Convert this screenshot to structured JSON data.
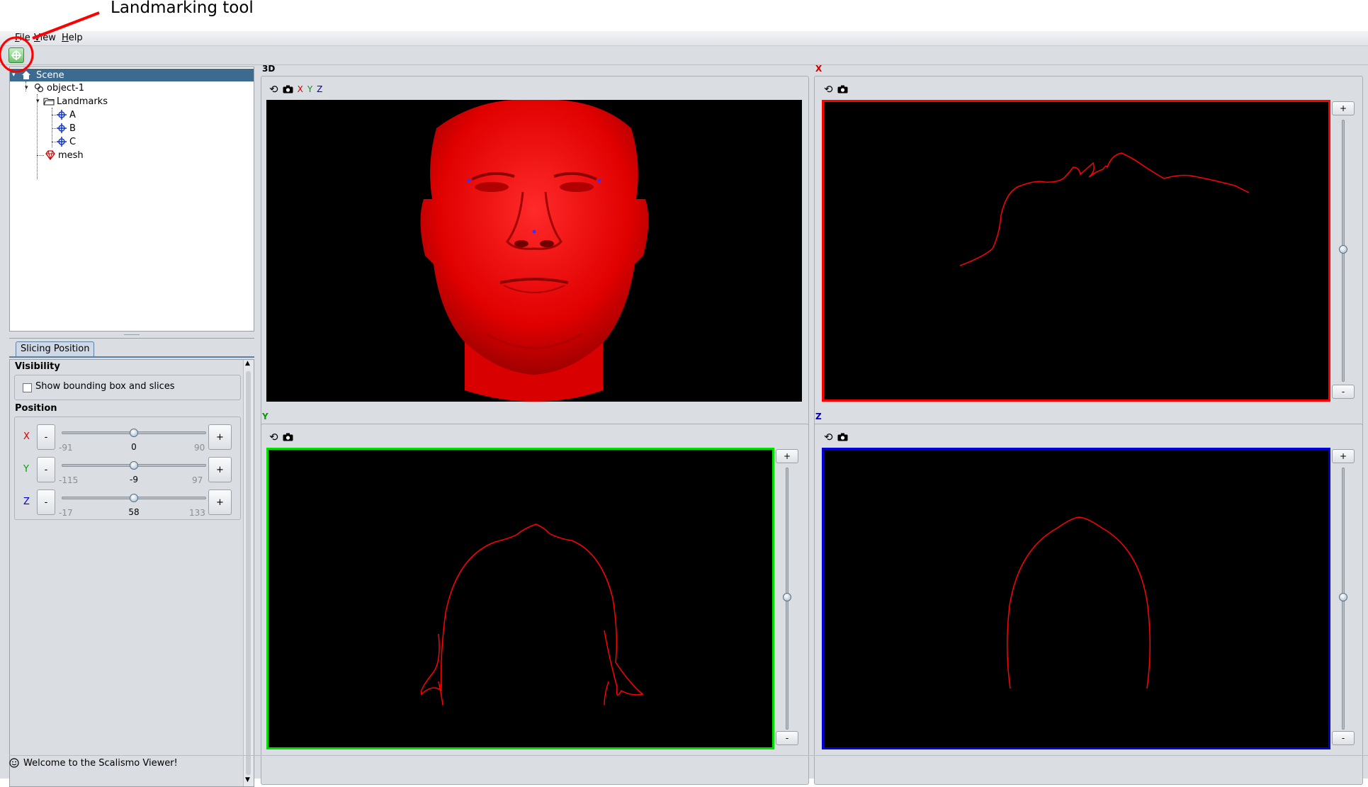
{
  "annotation": {
    "text": "Landmarking tool"
  },
  "menu": {
    "file": "File",
    "view": "View",
    "help": "Help"
  },
  "tree": {
    "scene": "Scene",
    "object": "object-1",
    "landmarks": "Landmarks",
    "landmark_items": [
      "A",
      "B",
      "C"
    ],
    "mesh": "mesh"
  },
  "properties": {
    "tab": "Slicing Position",
    "visibility_title": "Visibility",
    "show_bbox_label": "Show bounding box and slices",
    "show_bbox_checked": false,
    "position_title": "Position",
    "sliders": [
      {
        "axis": "X",
        "min": "-91",
        "value": "0",
        "max": "90",
        "color": "#cc0000",
        "fraction": 0.5
      },
      {
        "axis": "Y",
        "min": "-115",
        "value": "-9",
        "max": "97",
        "color": "#00a000",
        "fraction": 0.5
      },
      {
        "axis": "Z",
        "min": "-17",
        "value": "58",
        "max": "133",
        "color": "#0000cc",
        "fraction": 0.5
      }
    ],
    "minus": "-",
    "plus": "+"
  },
  "viewports": {
    "v3d": {
      "title": "3D",
      "axes": [
        "X",
        "Y",
        "Z"
      ]
    },
    "vx": {
      "title": "X",
      "border": "#ff0000",
      "title_color": "#cc0000"
    },
    "vy": {
      "title": "Y",
      "border": "#00dd00",
      "title_color": "#00a000"
    },
    "vz": {
      "title": "Z",
      "border": "#0000dd",
      "title_color": "#0000cc"
    },
    "plus": "+",
    "minus": "-"
  },
  "status": {
    "text": "Welcome to the Scalismo Viewer!"
  },
  "colors": {
    "mesh": "#ff0000",
    "background": "#000000",
    "selection": "#3d6a8f"
  }
}
